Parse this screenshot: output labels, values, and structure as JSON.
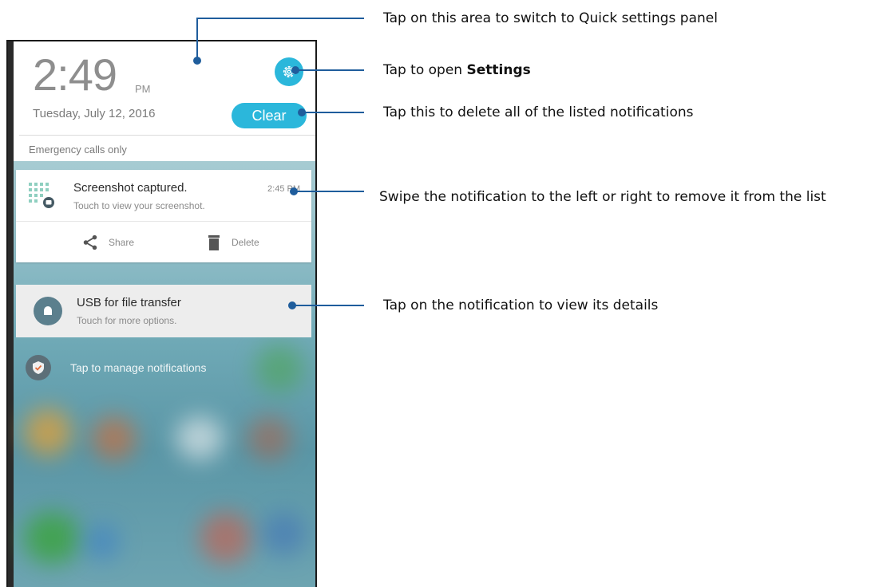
{
  "phone": {
    "header": {
      "clock": "2:49",
      "ampm": "PM",
      "date": "Tuesday, July 12, 2016",
      "clear_label": "Clear",
      "emergency": "Emergency calls only"
    },
    "notification_screenshot": {
      "title": "Screenshot captured.",
      "subtitle": "Touch to view your screenshot.",
      "time": "2:45 PM",
      "share_label": "Share",
      "delete_label": "Delete"
    },
    "notification_usb": {
      "title": "USB for file transfer",
      "subtitle": "Touch for more options."
    },
    "manage_label": "Tap to manage notifications"
  },
  "callouts": {
    "quick_settings": "Tap on this area to switch to Quick settings panel",
    "settings_prefix": "Tap to open ",
    "settings_bold": "Settings",
    "clear": "Tap this to delete all of the listed notifications",
    "swipe": "Swipe the notification to the left or right to remove it from the list",
    "details": "Tap on the notification to view its details"
  },
  "colors": {
    "accent": "#2bb7db",
    "callout_line": "#1f5d9c"
  }
}
